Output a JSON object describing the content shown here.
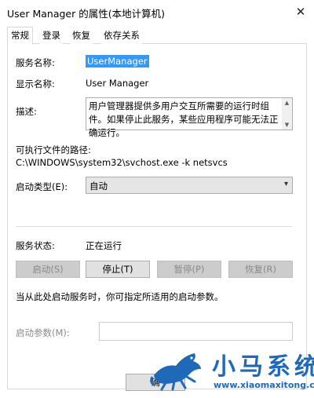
{
  "window": {
    "title": "User Manager 的属性(本地计算机)",
    "close_glyph": "✕"
  },
  "tabs": [
    {
      "label": "常规",
      "active": true
    },
    {
      "label": "登录",
      "active": false
    },
    {
      "label": "恢复",
      "active": false
    },
    {
      "label": "依存关系",
      "active": false
    }
  ],
  "general": {
    "service_name_label": "服务名称:",
    "service_name_value": "UserManager",
    "display_name_label": "显示名称:",
    "display_name_value": "User Manager",
    "description_label": "描述:",
    "description_value": "用户管理器提供多用户交互所需要的运行时组件。如果停止此服务，某些应用程序可能无法正确运行。",
    "path_label": "可执行文件的路径:",
    "path_value": "C:\\WINDOWS\\system32\\svchost.exe -k netsvcs",
    "startup_type_label": "启动类型(E):",
    "startup_type_value": "自动",
    "service_status_label": "服务状态:",
    "service_status_value": "正在运行",
    "buttons": {
      "start": "启动(S)",
      "stop": "停止(T)",
      "pause": "暂停(P)",
      "resume": "恢复(R)"
    },
    "params_hint": "当从此处启动服务时，你可指定所适用的启动参数。",
    "start_params_label": "启动参数(M):",
    "start_params_value": ""
  },
  "footer": {
    "ok_label": "确"
  },
  "watermark": {
    "title": "小马系统",
    "url": "www.xiaomaxitong.com",
    "color": "#1f69b9"
  },
  "icons": {
    "close": "close-icon",
    "dropdown": "chevron-down-icon",
    "scroll_up": "scroll-up-arrow-icon",
    "scroll_down": "scroll-down-arrow-icon",
    "logo": "horse-logo-icon"
  }
}
